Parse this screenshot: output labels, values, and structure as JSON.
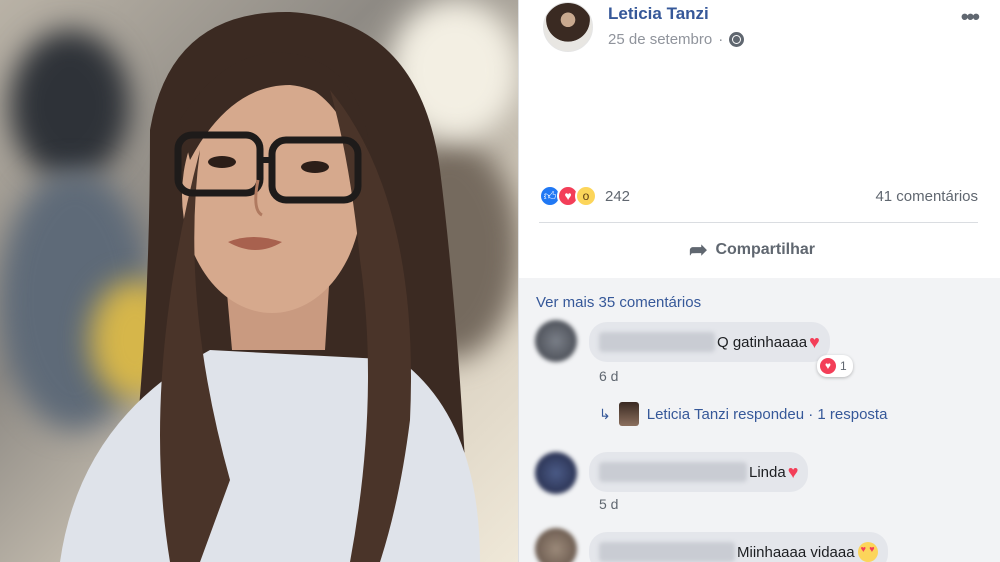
{
  "post": {
    "author": "Leticia Tanzi",
    "date": "25 de setembro",
    "date_separator": "·",
    "privacy_icon": "globe-icon"
  },
  "stats": {
    "reaction_icons": [
      "like-icon",
      "love-icon",
      "wow-icon"
    ],
    "reaction_count": "242",
    "comments_count": "41 comentários"
  },
  "actions": {
    "share_label": "Compartilhar",
    "share_icon": "share-arrow-icon"
  },
  "comments": {
    "see_more": "Ver mais 35 comentários",
    "items": [
      {
        "text": "Q gatinhaaaa",
        "emoji": "heart",
        "time": "6 d",
        "reaction_count": "1"
      },
      {
        "text": "Linda",
        "emoji": "heart",
        "time": "5 d"
      },
      {
        "text": "Miinhaaaa vidaaa",
        "emoji": "heart-eyes"
      }
    ],
    "reply": {
      "label": "Leticia Tanzi respondeu · 1 resposta"
    }
  },
  "colors": {
    "link": "#365899",
    "love": "#f33e58",
    "like": "#2078f4",
    "wow": "#fcd55a"
  }
}
